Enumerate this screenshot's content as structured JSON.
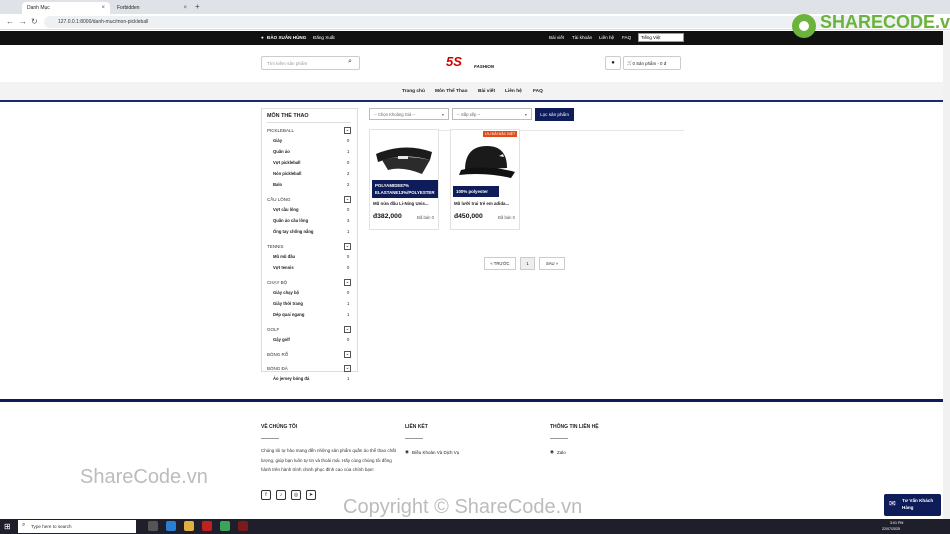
{
  "browser": {
    "tabs": [
      {
        "label": "Danh Mục"
      },
      {
        "label": "Forbidden"
      }
    ],
    "url": "127.0.0.1:8000/danh-muc/mon-pickleball"
  },
  "topbar": {
    "user": "ĐÀO XUÂN HÙNG",
    "logout": "Đăng Xuất",
    "links": [
      "Bài viết",
      "Tài khoản",
      "Liên hệ",
      "FAQ"
    ],
    "language": "Tiếng Việt"
  },
  "header": {
    "search_placeholder": "Tìm kiếm sản phẩm",
    "logo": "5S",
    "logo_sub": "FASHION",
    "cart": "0 Sản phẩm - 0 đ"
  },
  "menu": [
    "Trang chủ",
    "Môn Thể Thao",
    "Bài viết",
    "Liên hệ",
    "FAQ"
  ],
  "sidebar": {
    "title": "MÔN THỂ THAO",
    "categories": [
      {
        "name": "PICKLEBALL",
        "items": [
          {
            "label": "Giày",
            "count": "0"
          },
          {
            "label": "Quần áo",
            "count": "1"
          },
          {
            "label": "Vợt pickleball",
            "count": "0"
          },
          {
            "label": "Nón pickleball",
            "count": "2"
          },
          {
            "label": "Balo",
            "count": "2"
          }
        ]
      },
      {
        "name": "CẦU LÔNG",
        "items": [
          {
            "label": "Vợt cầu lông",
            "count": "0"
          },
          {
            "label": "Quần áo cầu lông",
            "count": "3"
          },
          {
            "label": "Ống tay chống nắng",
            "count": "1"
          }
        ]
      },
      {
        "name": "TENNIS",
        "items": [
          {
            "label": "Mũ mũ đầu",
            "count": "0"
          },
          {
            "label": "Vợt tennis",
            "count": "0"
          }
        ]
      },
      {
        "name": "CHẠY BỘ",
        "items": [
          {
            "label": "Giày chạy bộ",
            "count": "0"
          },
          {
            "label": "Giày thời trang",
            "count": "1"
          },
          {
            "label": "Dép quai ngang",
            "count": "1"
          }
        ]
      },
      {
        "name": "GOLF",
        "items": [
          {
            "label": "Gậy golf",
            "count": "0"
          }
        ]
      },
      {
        "name": "BÓNG RỔ",
        "items": []
      },
      {
        "name": "BÓNG ĐÁ",
        "items": [
          {
            "label": "Áo jersey bóng đá",
            "count": "1"
          }
        ]
      }
    ]
  },
  "filters": {
    "price": "-- Chọn Khoảng Giá --",
    "sort": "-- Sắp xếp --",
    "button": "Lọc sản phẩm"
  },
  "products": [
    {
      "badge_line1": "POLYAMIDE87%",
      "badge_line2": "ELASTANE13%/POLYESTER",
      "name": "Mũ nửa đầu Li-Ning Unis...",
      "price": "đ382,000",
      "sold": "Đã bán 0",
      "sale": ""
    },
    {
      "badge_line1": "100% polyester",
      "badge_line2": "",
      "name": "Mũ lưỡi trai trẻ em adida...",
      "price": "đ450,000",
      "sold": "Đã bán 0",
      "sale": "ƯU ĐÃI ĐẶC BIỆT"
    }
  ],
  "pagination": {
    "prev": "« TRƯỚC",
    "page": "1",
    "next": "SAU »"
  },
  "footer": {
    "about_title": "VỀ CHÚNG TÔI",
    "about_text": "Chúng tôi tự hào mang đến những sản phẩm quần áo thể thao chất lượng, giúp bạn luôn tự tin và thoải mái. Hãy cùng chúng tôi đồng hành trên hành trình chinh phục đỉnh cao của chính bạn!",
    "links_title": "LIÊN KẾT",
    "links_item": "Điều Khoản Và Dịch Vụ",
    "contact_title": "THÔNG TIN LIÊN HỆ",
    "contact_item": "Zalo",
    "chat_line1": "Tư Vấn Khách",
    "chat_line2": "Hàng"
  },
  "watermarks": {
    "left": "ShareCode.vn",
    "center": "Copyright © ShareCode.vn",
    "logo": "SHARECODE.vn"
  },
  "taskbar": {
    "search": "Type here to search",
    "time": "3:01 PM",
    "date": "22/07/2025"
  }
}
